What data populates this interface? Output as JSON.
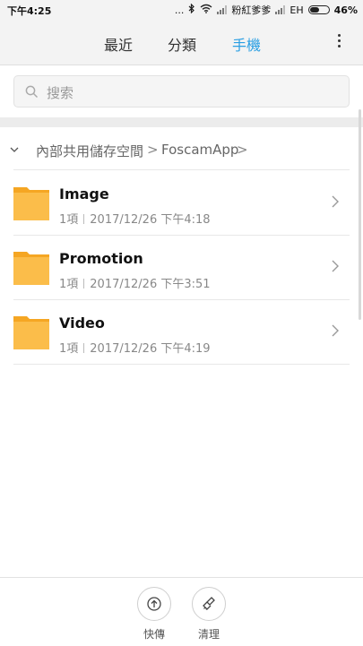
{
  "statusbar": {
    "time": "下午4:25",
    "dots": "...",
    "carrier": "粉紅爹爹",
    "network": "EH",
    "battery": "46%",
    "battery_level": 0.46
  },
  "header": {
    "tabs": [
      {
        "label": "最近"
      },
      {
        "label": "分類"
      },
      {
        "label": "手機"
      }
    ],
    "active_tab": "手機",
    "accent_color": "#2a9fe3"
  },
  "search": {
    "placeholder": "搜索"
  },
  "breadcrumb": {
    "items": [
      "內部共用儲存空間",
      "FoscamApp"
    ],
    "separator": ">"
  },
  "folders": [
    {
      "name": "Image",
      "count": "1項",
      "date": "2017/12/26 下午4:18"
    },
    {
      "name": "Promotion",
      "count": "1項",
      "date": "2017/12/26 下午3:51"
    },
    {
      "name": "Video",
      "count": "1項",
      "date": "2017/12/26 下午4:19"
    }
  ],
  "bottom": {
    "quick_transfer": "快傳",
    "clean": "清理"
  },
  "icons": {
    "search": "search-icon",
    "menu": "more-vert-icon",
    "folder": "folder-icon",
    "chevron": "chevron-right-icon",
    "collapse": "chevron-down-icon",
    "transfer": "upload-circle-icon",
    "clean": "broom-icon"
  }
}
